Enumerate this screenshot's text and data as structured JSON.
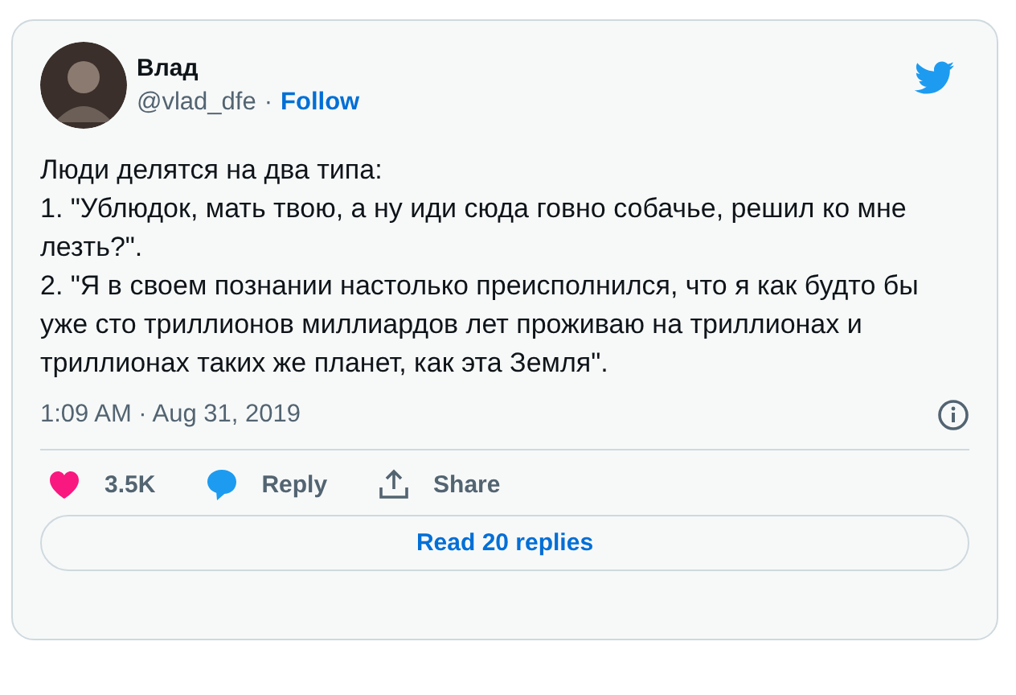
{
  "author": {
    "name": "Влад",
    "handle": "@vlad_dfe",
    "separator": "·",
    "follow": "Follow"
  },
  "paragraphs": [
    "Люди делятся на два типа:",
    "1. \"Ублюдок, мать твою, а ну иди сюда говно собачье, решил ко мне лезть?\".",
    "2. \"Я в своем познании настолько преисполнился, что я как будто бы уже сто триллионов миллиардов лет проживаю на триллионах и триллионах таких же планет, как эта Земля\"."
  ],
  "timestamp": "1:09 AM · Aug 31, 2019",
  "actions": [
    {
      "kind": "like",
      "label": "3.5K"
    },
    {
      "kind": "reply",
      "label": "Reply"
    },
    {
      "kind": "share",
      "label": "Share"
    }
  ],
  "read_replies": "Read 20 replies"
}
